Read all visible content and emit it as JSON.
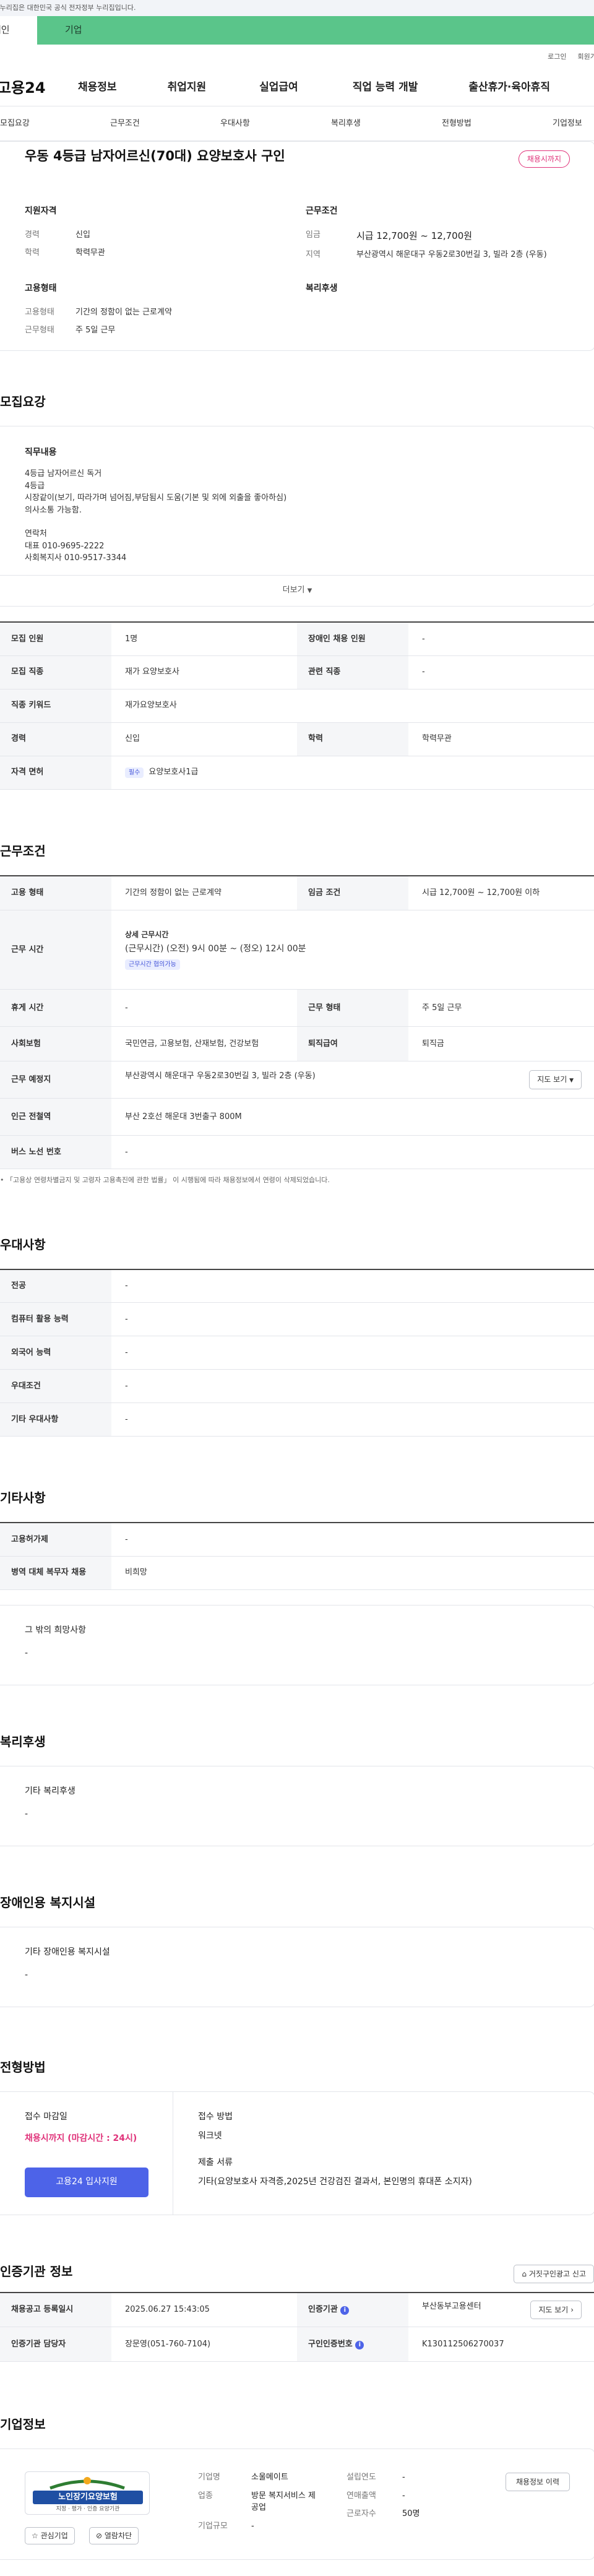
{
  "gov_banner": "이 누리집은 대한민국 공식 전자정부 누리집입니다.",
  "tabs": {
    "personal": "개인",
    "corporate": "기업"
  },
  "util": {
    "login": "로그인",
    "signup": "회원가입"
  },
  "logo": "고용24",
  "gnb": [
    "채용정보",
    "취업지원",
    "실업급여",
    "직업 능력 개발",
    "출산휴가·육아휴직"
  ],
  "anchor_nav": [
    "모집요강",
    "근무조건",
    "우대사항",
    "복리후생",
    "전형방법",
    "기업정보"
  ],
  "summary": {
    "title": "우동 4등급 남자어르신(70대) 요양보호사 구인",
    "badge": "채용시까지",
    "qual_heading": "지원자격",
    "work_heading": "근무조건",
    "emp_heading": "고용형태",
    "welfare_heading": "복리후생",
    "qual_rows": [
      {
        "k": "경력",
        "v": "신입"
      },
      {
        "k": "학력",
        "v": "학력무관"
      }
    ],
    "work_rows": [
      {
        "k": "임금",
        "v": "시급 12,700원 ~ 12,700원"
      },
      {
        "k": "지역",
        "v": "부산광역시 해운대구 우동2로30번길 3, 빌라 2층 (우동)"
      }
    ],
    "emp_rows": [
      {
        "k": "고용형태",
        "v": "기간의 정함이 없는 근로계약"
      },
      {
        "k": "근무형태",
        "v": "주 5일 근무"
      }
    ]
  },
  "recruit": {
    "title": "모집요강",
    "duty_label": "직무내용",
    "duty_lines": [
      "4등급 남자어르신 독거",
      "4등급",
      "시장같이(보기, 따라가며 넘어짐,부담됨시 도움(기본 및 외에 외출을 좋아하심)",
      "의사소통 가능함.",
      "",
      "연락처",
      "대표 010-9695-2222",
      "사회복지사 010-9517-3344"
    ],
    "more": "더보기",
    "table": {
      "r1": {
        "k1": "모집 인원",
        "v1": "1명",
        "k2": "장애인 채용 인원",
        "v2": "-"
      },
      "r2": {
        "k1": "모집 직종",
        "v1": "재가 요양보호사",
        "k2": "관련 직종",
        "v2": "-"
      },
      "r3": {
        "k1": "직종 키워드",
        "v1": "재가요양보호사"
      },
      "r4": {
        "k1": "경력",
        "v1": "신입",
        "k2": "학력",
        "v2": "학력무관"
      },
      "r5": {
        "k1": "자격 면허",
        "chip": "필수",
        "v1": "요양보호사1급"
      }
    }
  },
  "work": {
    "title": "근무조건",
    "rows": {
      "emp_type_k": "고용 형태",
      "emp_type_v": "기간의 정함이 없는 근로계약",
      "wage_k": "임금 조건",
      "wage_v": "시급 12,700원 ~ 12,700원 이하",
      "hours_k": "근무 시간",
      "hours_detail_title": "상세 근무시간",
      "hours_detail": "(근무시간) (오전) 9시 00분 ~ (정오) 12시 00분",
      "hours_chip": "근무시간 협의가능",
      "rest_k": "휴게 시간",
      "rest_v": "-",
      "worktype_k": "근무 형태",
      "worktype_v": "주 5일 근무",
      "insurance_k": "사회보험",
      "insurance_v": "국민연금, 고용보험, 산재보험, 건강보험",
      "retire_k": "퇴직급여",
      "retire_v": "퇴직금",
      "place_k": "근무 예정지",
      "place_v": "부산광역시 해운대구 우동2로30번길 3, 빌라 2층 (우동)",
      "map_btn": "지도 보기",
      "station_k": "인근 전철역",
      "station_v": "부산 2호선 해운대 3번출구 800M",
      "bus_k": "버스 노선 번호",
      "bus_v": "-"
    },
    "note": "「고용상 연령차별금지 및 고령자 고용촉진에 관한 법률」 이 시행됨에 따라 채용정보에서 연령이 삭제되었습니다."
  },
  "pref": {
    "title": "우대사항",
    "rows": [
      {
        "k": "전공",
        "v": "-"
      },
      {
        "k": "컴퓨터 활용 능력",
        "v": "-"
      },
      {
        "k": "외국어 능력",
        "v": "-"
      },
      {
        "k": "우대조건",
        "v": "-"
      },
      {
        "k": "기타 우대사항",
        "v": "-"
      }
    ]
  },
  "etc": {
    "title": "기타사항",
    "rows": [
      {
        "k": "고용허가제",
        "v": "-"
      },
      {
        "k": "병역 대체 복무자 채용",
        "v": "비희망"
      }
    ],
    "other_label": "그 밖의 희망사항",
    "other_value": "-"
  },
  "welfare": {
    "title": "복리후생",
    "label": "기타 복리후생",
    "value": "-"
  },
  "disability": {
    "title": "장애인용 복지시설",
    "label": "기타 장애인용 복지시설",
    "value": "-"
  },
  "selection": {
    "title": "전형방법",
    "deadline_label": "접수 마감일",
    "deadline_value": "채용시까지 (마감시간 : 24시)",
    "apply_btn": "고용24 입사지원",
    "method_label": "접수 방법",
    "method_value": "워크넷",
    "docs_label": "제출 서류",
    "docs_value": "기타(요양보호사 자격증,2025년 건강검진 결과서, 본인명의 휴대폰 소지자)"
  },
  "cert": {
    "title": "인증기관 정보",
    "report_btn": "거짓구인광고 신고",
    "reg_k": "채용공고 등록일시",
    "reg_v": "2025.06.27 15:43:05",
    "org_k": "인증기관",
    "org_v": "부산동부고용센터",
    "map_btn": "지도 보기",
    "mgr_k": "인증기관 담당자",
    "mgr_v": "장문영(051-760-7104)",
    "cert_no_k": "구인인증번호",
    "cert_no_v": "K130112506270037"
  },
  "company": {
    "title": "기업정보",
    "logo_text": "노인장기요양보험",
    "logo_sub": "지정 · 평가 · 인증 요양기관",
    "fav_btn": "관심기업",
    "block_btn": "열람차단",
    "name_k": "기업명",
    "name_v": "소울메이트",
    "industry_k": "업종",
    "industry_v": "방문 복지서비스 제공업",
    "size_k": "기업규모",
    "size_v": "-",
    "founded_k": "설립연도",
    "founded_v": "-",
    "sales_k": "연매출액",
    "sales_v": "-",
    "staff_k": "근로자수",
    "staff_v": "50명",
    "history_btn": "채용정보 이력"
  }
}
